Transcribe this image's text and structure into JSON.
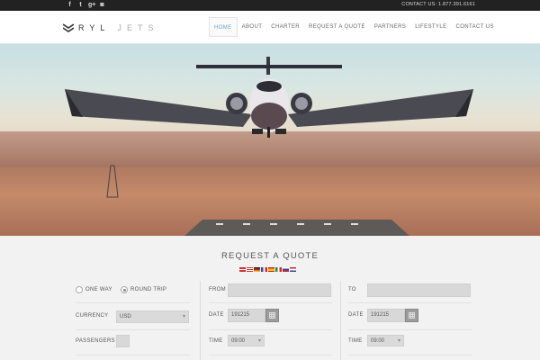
{
  "topbar": {
    "social_icons": [
      "facebook-icon",
      "twitter-icon",
      "google-plus-icon",
      "instagram-icon"
    ],
    "social_glyphs": [
      "f",
      "t",
      "g+",
      "◙"
    ],
    "contact": "CONTACT US: 1.877.391.6161"
  },
  "brand": {
    "logo_bold": "RYL",
    "logo_light": "JETS",
    "accent": "#6b9ec5"
  },
  "nav": {
    "items": [
      {
        "label": "HOME",
        "active": true
      },
      {
        "label": "ABOUT",
        "active": false
      },
      {
        "label": "CHARTER",
        "active": false
      },
      {
        "label": "REQUEST A QUOTE",
        "active": false
      },
      {
        "label": "PARTNERS",
        "active": false
      },
      {
        "label": "LIFESTYLE",
        "active": false
      },
      {
        "label": "CONTACT US",
        "active": false
      }
    ]
  },
  "quote": {
    "title": "REQUEST A QUOTE",
    "languages": [
      "english-flag",
      "american-flag",
      "german-flag",
      "french-flag",
      "spanish-flag",
      "italian-flag",
      "russian-flag",
      "dutch-flag"
    ],
    "trip_type": {
      "one_way": "ONE WAY",
      "round_trip": "ROUND TRIP",
      "selected": "round_trip"
    },
    "currency": {
      "label": "CURRENCY",
      "value": "USD"
    },
    "passengers": {
      "label": "PASSENGERS",
      "value": ""
    },
    "outbound": {
      "from_label": "FROM",
      "from_value": "",
      "date_label": "DATE",
      "date_value": "191215",
      "time_label": "TIME",
      "time_value": "09:00"
    },
    "return": {
      "to_label": "TO",
      "to_value": "",
      "date_label": "DATE",
      "date_value": "191215",
      "time_label": "TIME",
      "time_value": "09:00"
    }
  }
}
